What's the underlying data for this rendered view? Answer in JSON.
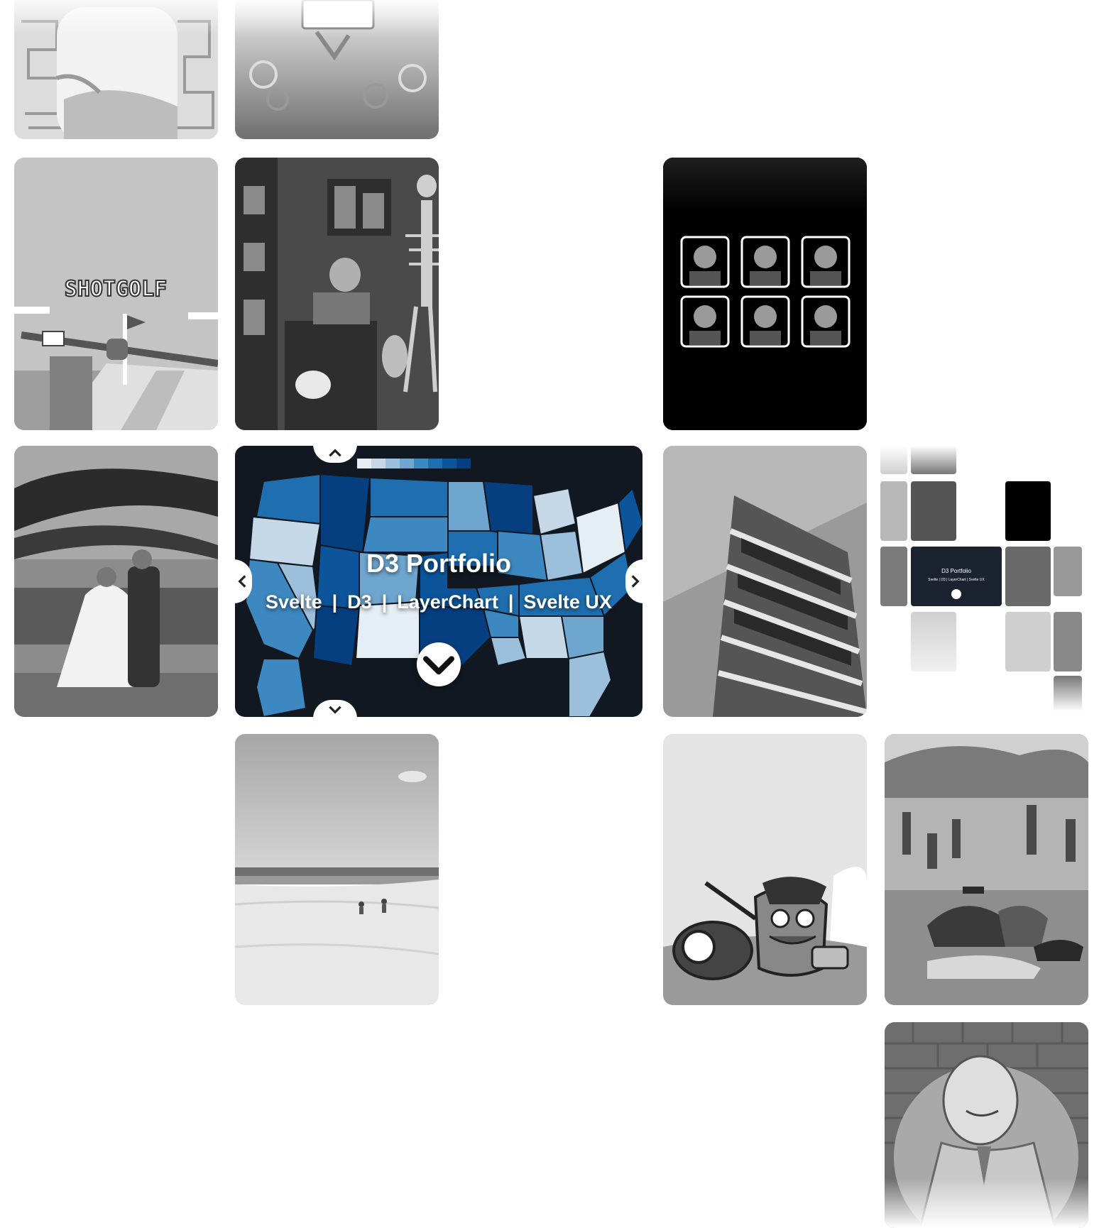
{
  "featured": {
    "title": "D3 Portfolio",
    "tags": [
      "Svelte",
      "D3",
      "LayerChart",
      "Svelte UX"
    ],
    "legend_colors": [
      "#e6eef5",
      "#c4d8e8",
      "#9cc0dc",
      "#6ea6cf",
      "#3d88c0",
      "#1f6fb0",
      "#0d559a",
      "#063f80"
    ]
  },
  "minimap": {
    "title": "D3 Portfolio",
    "tags": "Svelte | D3 | LayerChart | Svelte UX"
  },
  "tiles": {
    "game_title": "SHOTGOLF"
  },
  "colors": {
    "featured_bg": "#111821",
    "page_bg": "#ffffff"
  }
}
